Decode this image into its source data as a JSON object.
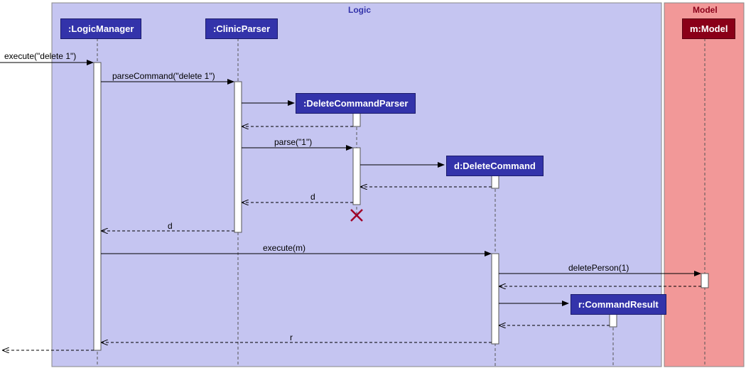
{
  "frames": {
    "logic": {
      "label": "Logic"
    },
    "model": {
      "label": "Model"
    }
  },
  "participants": {
    "logicManager": ":LogicManager",
    "clinicParser": ":ClinicParser",
    "deleteCommandParser": ":DeleteCommandParser",
    "deleteCommand": "d:DeleteCommand",
    "commandResult": "r:CommandResult",
    "model": "m:Model"
  },
  "messages": {
    "execute1": "execute(\"delete 1\")",
    "parseCommand": "parseCommand(\"delete 1\")",
    "parse": "parse(\"1\")",
    "returnD1": "d",
    "returnD2": "d",
    "executeM": "execute(m)",
    "deletePerson": "deletePerson(1)",
    "returnR": "r"
  },
  "chart_data": {
    "type": "sequence_diagram",
    "frames": [
      {
        "name": "Logic",
        "participants": [
          ":LogicManager",
          ":ClinicParser",
          ":DeleteCommandParser",
          "d:DeleteCommand",
          "r:CommandResult"
        ]
      },
      {
        "name": "Model",
        "participants": [
          "m:Model"
        ]
      }
    ],
    "lifelines": [
      ":LogicManager",
      ":ClinicParser",
      ":DeleteCommandParser",
      "d:DeleteCommand",
      "r:CommandResult",
      "m:Model"
    ],
    "messages": [
      {
        "from": "external",
        "to": ":LogicManager",
        "label": "execute(\"delete 1\")",
        "type": "call"
      },
      {
        "from": ":LogicManager",
        "to": ":ClinicParser",
        "label": "parseCommand(\"delete 1\")",
        "type": "call"
      },
      {
        "from": ":ClinicParser",
        "to": ":DeleteCommandParser",
        "label": "",
        "type": "create"
      },
      {
        "from": ":DeleteCommandParser",
        "to": ":ClinicParser",
        "label": "",
        "type": "return"
      },
      {
        "from": ":ClinicParser",
        "to": ":DeleteCommandParser",
        "label": "parse(\"1\")",
        "type": "call"
      },
      {
        "from": ":DeleteCommandParser",
        "to": "d:DeleteCommand",
        "label": "",
        "type": "create"
      },
      {
        "from": "d:DeleteCommand",
        "to": ":DeleteCommandParser",
        "label": "",
        "type": "return"
      },
      {
        "from": ":DeleteCommandParser",
        "to": ":ClinicParser",
        "label": "d",
        "type": "return"
      },
      {
        "from": ":DeleteCommandParser",
        "to": null,
        "label": "",
        "type": "destroy"
      },
      {
        "from": ":ClinicParser",
        "to": ":LogicManager",
        "label": "d",
        "type": "return"
      },
      {
        "from": ":LogicManager",
        "to": "d:DeleteCommand",
        "label": "execute(m)",
        "type": "call"
      },
      {
        "from": "d:DeleteCommand",
        "to": "m:Model",
        "label": "deletePerson(1)",
        "type": "call"
      },
      {
        "from": "m:Model",
        "to": "d:DeleteCommand",
        "label": "",
        "type": "return"
      },
      {
        "from": "d:DeleteCommand",
        "to": "r:CommandResult",
        "label": "",
        "type": "create"
      },
      {
        "from": "r:CommandResult",
        "to": "d:DeleteCommand",
        "label": "",
        "type": "return"
      },
      {
        "from": "d:DeleteCommand",
        "to": ":LogicManager",
        "label": "r",
        "type": "return"
      },
      {
        "from": ":LogicManager",
        "to": "external",
        "label": "",
        "type": "return"
      }
    ]
  }
}
